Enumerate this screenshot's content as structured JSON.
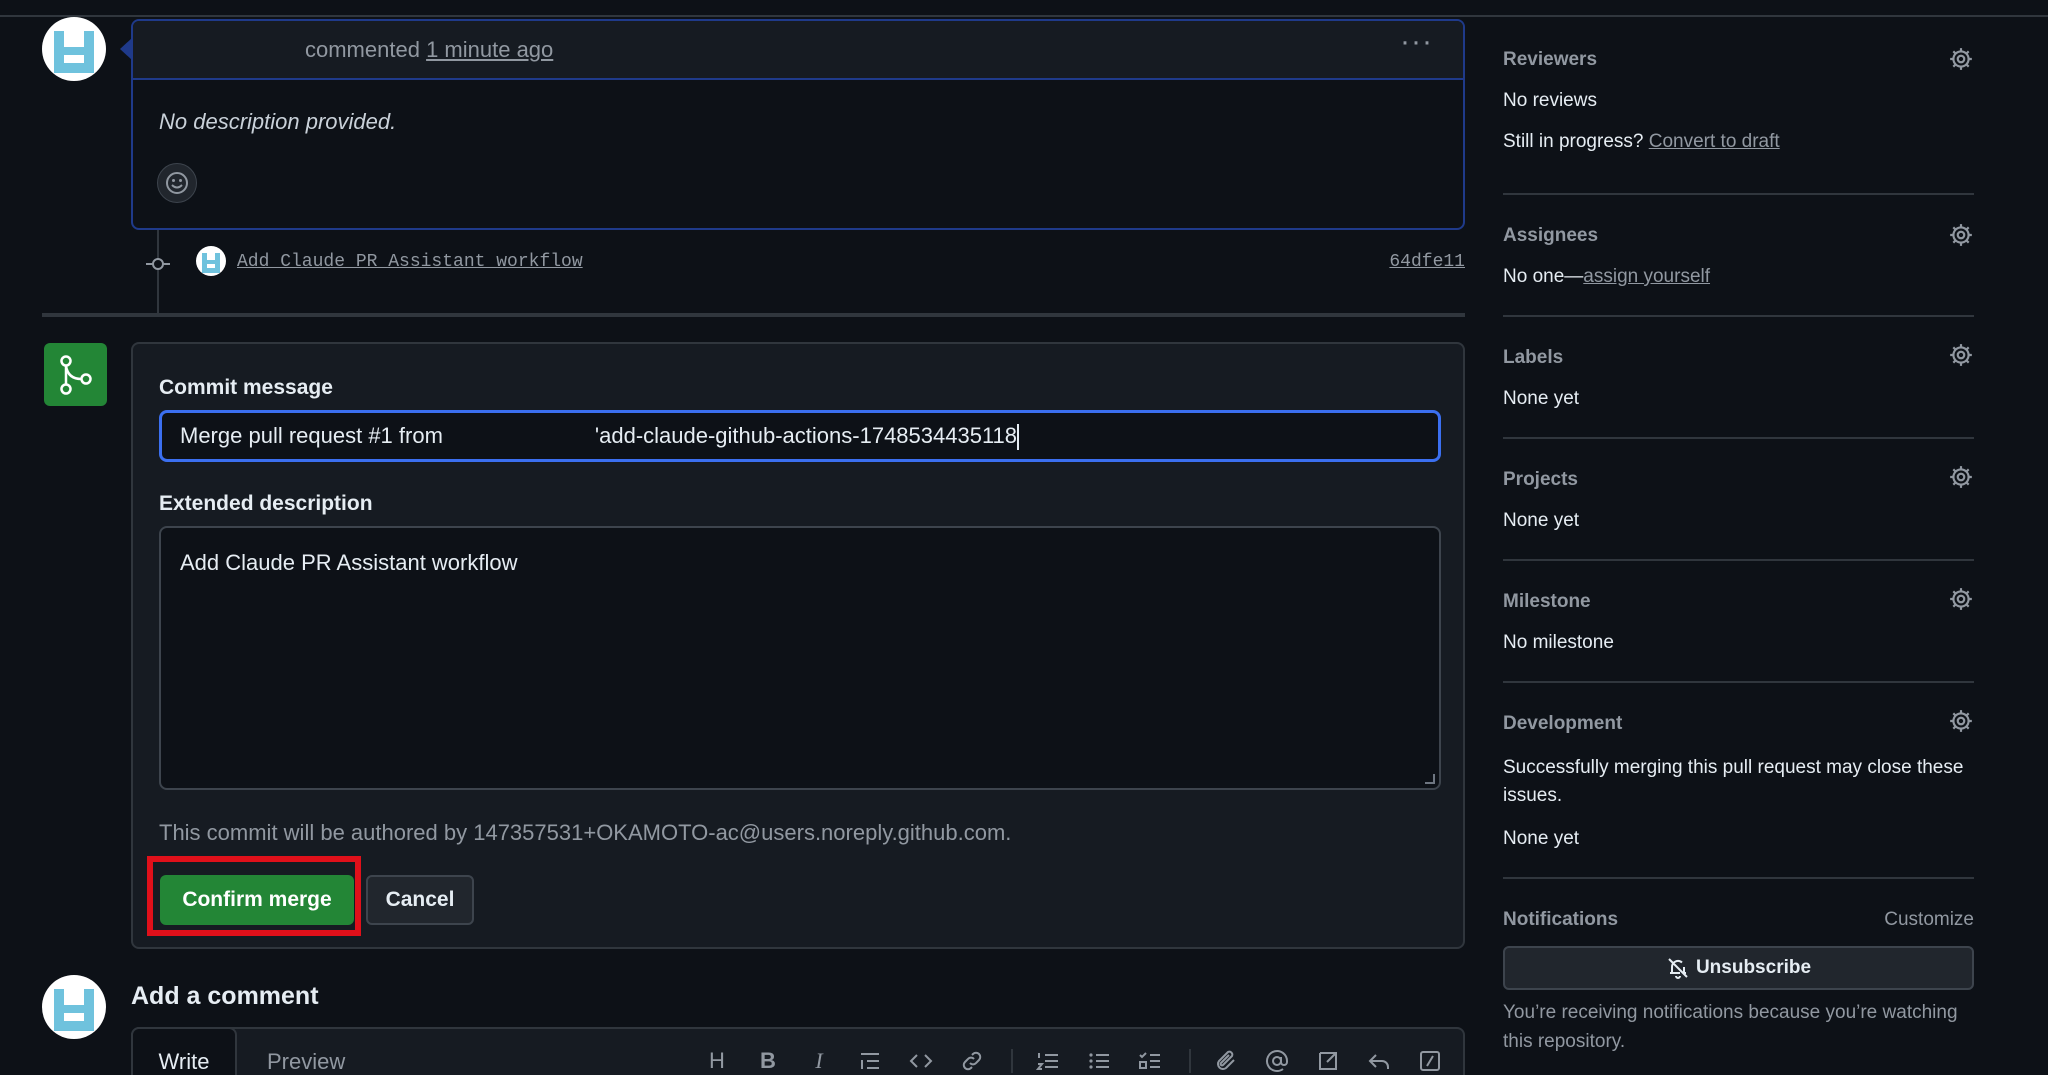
{
  "comment": {
    "action_text": "commented",
    "time_link": "1 minute ago",
    "more_label": "···",
    "body": "No description provided."
  },
  "commit": {
    "message": "Add Claude PR Assistant workflow",
    "sha": "64dfe11"
  },
  "merge": {
    "commit_message_label": "Commit message",
    "commit_message_prefix": "Merge pull request #1 from",
    "commit_message_suffix": "'add-claude-github-actions-1748534435118",
    "extended_description_label": "Extended description",
    "extended_description_value": "Add Claude PR Assistant workflow",
    "author_note": "This commit will be authored by 147357531+OKAMOTO-ac@users.noreply.github.com.",
    "confirm_label": "Confirm merge",
    "cancel_label": "Cancel"
  },
  "add_comment": {
    "title": "Add a comment",
    "tab_write": "Write",
    "tab_preview": "Preview"
  },
  "sidebar": {
    "reviewers": {
      "title": "Reviewers",
      "value": "No reviews",
      "extra_prefix": "Still in progress?",
      "extra_link": "Convert to draft"
    },
    "assignees": {
      "title": "Assignees",
      "value_prefix": "No one—",
      "value_link": "assign yourself"
    },
    "labels": {
      "title": "Labels",
      "value": "None yet"
    },
    "projects": {
      "title": "Projects",
      "value": "None yet"
    },
    "milestone": {
      "title": "Milestone",
      "value": "No milestone"
    },
    "development": {
      "title": "Development",
      "description": "Successfully merging this pull request may close these issues.",
      "value": "None yet"
    },
    "notifications": {
      "title": "Notifications",
      "customize": "Customize",
      "unsubscribe_label": "Unsubscribe",
      "note": "You’re receiving notifications because you’re watching this repository."
    }
  },
  "colors": {
    "accent_green": "#238636",
    "focus_blue": "#3b6ff0",
    "highlight_red": "#e0101a",
    "background": "#0d1117"
  }
}
